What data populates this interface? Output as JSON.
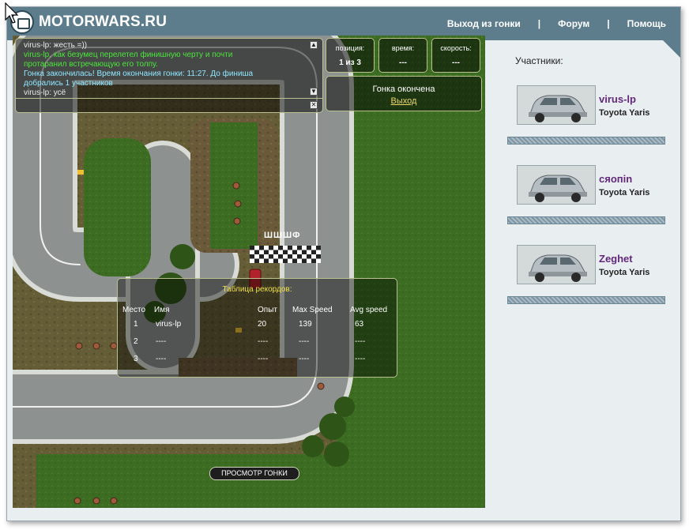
{
  "header": {
    "logo_text": "MOTORWARS.RU",
    "nav": [
      {
        "label": "Выход из гонки"
      },
      {
        "label": "Форум"
      },
      {
        "label": "Помощь"
      }
    ],
    "separator": "|"
  },
  "chat": {
    "lines": [
      {
        "text": "virus-lp: жесть =))",
        "color": "#e8e8e8"
      },
      {
        "text": "virus-lp, как безумец перелетел финишную черту и почти",
        "color": "#4be53b"
      },
      {
        "text": "протаранил встречающую его толпу.",
        "color": "#4be53b"
      },
      {
        "text": "Гонка закончилась! Время окончания гонки: 11:27. До финиша",
        "color": "#8fe8ff"
      },
      {
        "text": "добрались 1 участников",
        "color": "#8fe8ff"
      },
      {
        "text": "virus-lp: усё",
        "color": "#e8e8e8"
      }
    ]
  },
  "stats": {
    "position_label": "позиция:",
    "position_value": "1 из 3",
    "time_label": "время:",
    "time_value": "---",
    "speed_label": "скорость:",
    "speed_value": "---"
  },
  "status": {
    "text": "Гонка окончена",
    "link": "Выход"
  },
  "track": {
    "finish_label": "ШШШФ"
  },
  "records": {
    "title": "Таблица рекордов:",
    "headers": [
      "Место",
      "Имя",
      "Опыт",
      "Max Speed",
      "Avg speed"
    ],
    "rows": [
      [
        "1",
        "virus-lp",
        "20",
        "139",
        "63"
      ],
      [
        "2",
        "----",
        "----",
        "----",
        "----"
      ],
      [
        "3",
        "----",
        "----",
        "----",
        "----"
      ]
    ]
  },
  "review_button": "ПРОСМОТР ГОНКИ",
  "sidebar": {
    "title": "Участники:",
    "participants": [
      {
        "name": "virus-lp",
        "car": "Toyota Yaris"
      },
      {
        "name": "сяопin",
        "car": "Toyota Yaris"
      },
      {
        "name": "Zeghet",
        "car": "Toyota Yaris"
      }
    ]
  },
  "colors": {
    "header_bg": "#5d7d8d",
    "name_color": "#62287a",
    "chat_green": "#4be53b",
    "chat_cyan": "#8fe8ff",
    "records_title": "#f0e04a"
  }
}
